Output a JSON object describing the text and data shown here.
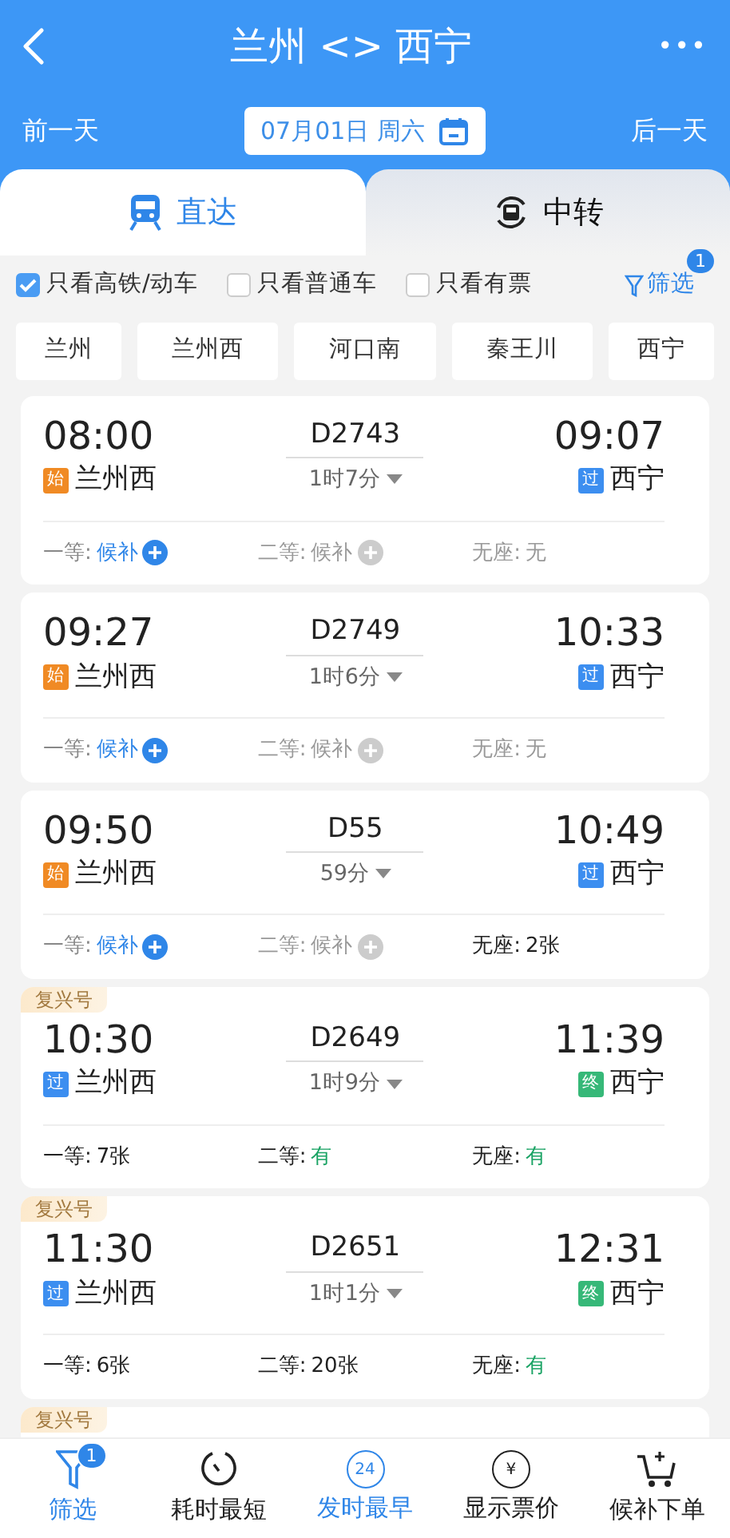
{
  "header": {
    "title": "兰州 <> 西宁",
    "more": "•••",
    "prev_day": "前一天",
    "date": "07月01日 周六",
    "next_day": "后一天"
  },
  "tabs": [
    {
      "label": "直达",
      "kind": "train",
      "selected": true
    },
    {
      "label": "中转",
      "kind": "transfer",
      "selected": false
    }
  ],
  "filters": [
    {
      "label": "只看高铁/动车",
      "checked": true
    },
    {
      "label": "只看普通车",
      "checked": false
    },
    {
      "label": "只看有票",
      "checked": false
    }
  ],
  "filter_button": {
    "label": "筛选",
    "badge": "1"
  },
  "stations": [
    "兰州",
    "兰州西",
    "河口南",
    "秦王川",
    "西宁"
  ],
  "trains": [
    {
      "depart": "08:00",
      "from": {
        "mark": "始",
        "color": "#f08a24",
        "name": "兰州西"
      },
      "number": "D2743",
      "duration": "1时7分",
      "arrive": "09:07",
      "to": {
        "mark": "过",
        "color": "#3c8ef0",
        "name": "西宁"
      },
      "seats": [
        {
          "label": "一等:",
          "value": "候补",
          "kind": "waitlist"
        },
        {
          "label": "二等:",
          "value": "候补",
          "kind": "disabled"
        },
        {
          "label": "无座:",
          "value": "无",
          "kind": "none"
        }
      ]
    },
    {
      "depart": "09:27",
      "from": {
        "mark": "始",
        "color": "#f08a24",
        "name": "兰州西"
      },
      "number": "D2749",
      "duration": "1时6分",
      "arrive": "10:33",
      "to": {
        "mark": "过",
        "color": "#3c8ef0",
        "name": "西宁"
      },
      "seats": [
        {
          "label": "一等:",
          "value": "候补",
          "kind": "waitlist"
        },
        {
          "label": "二等:",
          "value": "候补",
          "kind": "disabled"
        },
        {
          "label": "无座:",
          "value": "无",
          "kind": "none"
        }
      ]
    },
    {
      "depart": "09:50",
      "from": {
        "mark": "始",
        "color": "#f08a24",
        "name": "兰州西"
      },
      "number": "D55",
      "duration": "59分",
      "arrive": "10:49",
      "to": {
        "mark": "过",
        "color": "#3c8ef0",
        "name": "西宁"
      },
      "seats": [
        {
          "label": "一等:",
          "value": "候补",
          "kind": "waitlist"
        },
        {
          "label": "二等:",
          "value": "候补",
          "kind": "disabled"
        },
        {
          "label": "无座:",
          "value": "2张",
          "kind": "count"
        }
      ]
    },
    {
      "tag": "复兴号",
      "depart": "10:30",
      "from": {
        "mark": "过",
        "color": "#3c8ef0",
        "name": "兰州西"
      },
      "number": "D2649",
      "duration": "1时9分",
      "arrive": "11:39",
      "to": {
        "mark": "终",
        "color": "#36b878",
        "name": "西宁"
      },
      "seats": [
        {
          "label": "一等:",
          "value": "7张",
          "kind": "count"
        },
        {
          "label": "二等:",
          "value": "有",
          "kind": "available"
        },
        {
          "label": "无座:",
          "value": "有",
          "kind": "available"
        }
      ]
    },
    {
      "tag": "复兴号",
      "depart": "11:30",
      "from": {
        "mark": "过",
        "color": "#3c8ef0",
        "name": "兰州西"
      },
      "number": "D2651",
      "duration": "1时1分",
      "arrive": "12:31",
      "to": {
        "mark": "终",
        "color": "#36b878",
        "name": "西宁"
      },
      "seats": [
        {
          "label": "一等:",
          "value": "6张",
          "kind": "count"
        },
        {
          "label": "二等:",
          "value": "20张",
          "kind": "count"
        },
        {
          "label": "无座:",
          "value": "有",
          "kind": "available"
        }
      ]
    },
    {
      "tag": "复兴号"
    }
  ],
  "bottom_nav": [
    {
      "label": "筛选",
      "kind": "filter",
      "badge": "1",
      "selected": true
    },
    {
      "label": "耗时最短",
      "kind": "timer",
      "selected": false
    },
    {
      "label": "发时最早",
      "kind": "clock",
      "icon_text": "24",
      "selected": true
    },
    {
      "label": "显示票价",
      "kind": "price",
      "icon_text": "¥",
      "selected": false
    },
    {
      "label": "候补下单",
      "kind": "cart",
      "selected": false
    }
  ]
}
